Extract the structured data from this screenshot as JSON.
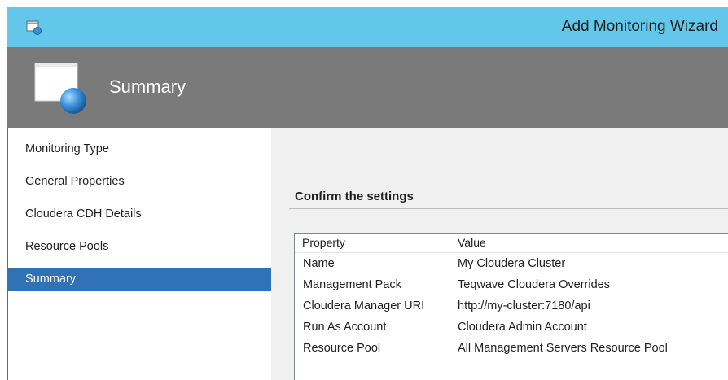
{
  "window": {
    "title": "Add Monitoring Wizard",
    "icon": "wizard-window-icon",
    "accent_color": "#63c7ea"
  },
  "banner": {
    "title": "Summary",
    "icon": "wizard-summary-icon",
    "background": "#7a7a7a"
  },
  "nav": {
    "selected_color": "#2f72b5",
    "items": [
      {
        "label": "Monitoring Type"
      },
      {
        "label": "General Properties"
      },
      {
        "label": "Cloudera CDH Details"
      },
      {
        "label": "Resource Pools"
      },
      {
        "label": "Summary",
        "selected": true
      }
    ]
  },
  "main": {
    "heading": "Confirm the settings",
    "table": {
      "columns": [
        "Property",
        "Value"
      ],
      "rows": [
        [
          "Name",
          "My Cloudera Cluster"
        ],
        [
          "Management Pack",
          "Teqwave Cloudera Overrides"
        ],
        [
          "Cloudera Manager URI",
          "http://my-cluster:7180/api"
        ],
        [
          "Run As Account",
          "Cloudera Admin Account"
        ],
        [
          "Resource Pool",
          "All Management Servers Resource Pool"
        ]
      ]
    }
  }
}
